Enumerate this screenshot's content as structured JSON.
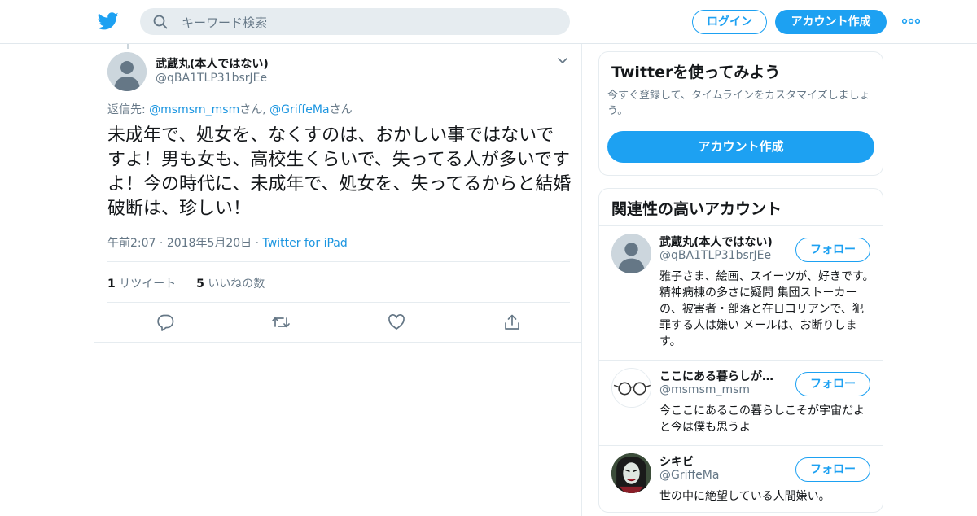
{
  "header": {
    "search_placeholder": "キーワード検索",
    "login_label": "ログイン",
    "signup_label": "アカウント作成",
    "brand_color": "#1da1f2"
  },
  "tweet": {
    "author_name": "武蔵丸(本人ではない)",
    "author_handle": "@qBA1TLP31bsrJEe",
    "reply_prefix": "返信先: ",
    "reply_to": [
      {
        "handle": "@msmsm_msm",
        "suffix": "さん"
      },
      {
        "handle": "@GriffeMa",
        "suffix": "さん"
      }
    ],
    "reply_separator": ", ",
    "text": "未成年で、処女を、なくすのは、おかしい事ではないですよ！男も女も、高校生くらいで、失ってる人が多いですよ！今の時代に、未成年で、処女を、失ってるからと結婚破断は、珍しい！",
    "time": "午前2:07",
    "date": "2018年5月20日",
    "meta_separator": " · ",
    "source": "Twitter for iPad",
    "retweet_count": "1",
    "retweet_label": "リツイート",
    "like_count": "5",
    "like_label": "いいねの数"
  },
  "signup_card": {
    "title": "Twitterを使ってみよう",
    "description": "今すぐ登録して、タイムラインをカスタマイズしましょう。",
    "button_label": "アカウント作成"
  },
  "related": {
    "title": "関連性の高いアカウント",
    "follow_label": "フォロー",
    "accounts": [
      {
        "name": "武蔵丸(本人ではない)",
        "handle": "@qBA1TLP31bsrJEe",
        "bio": "雅子さま、絵画、スイーツが、好きです。精神病棟の多さに疑問 集団ストーカーの、被害者・部落と在日コリアンで、犯罪する人は嫌い メールは、お断りします。"
      },
      {
        "name": "ここにある暮らしが…",
        "handle": "@msmsm_msm",
        "bio": "今ここにあるこの暮らしこそが宇宙だよと今は僕も思うよ"
      },
      {
        "name": "シキビ",
        "handle": "@GriffeMa",
        "bio": "世の中に絶望している人間嫌い。"
      }
    ]
  }
}
